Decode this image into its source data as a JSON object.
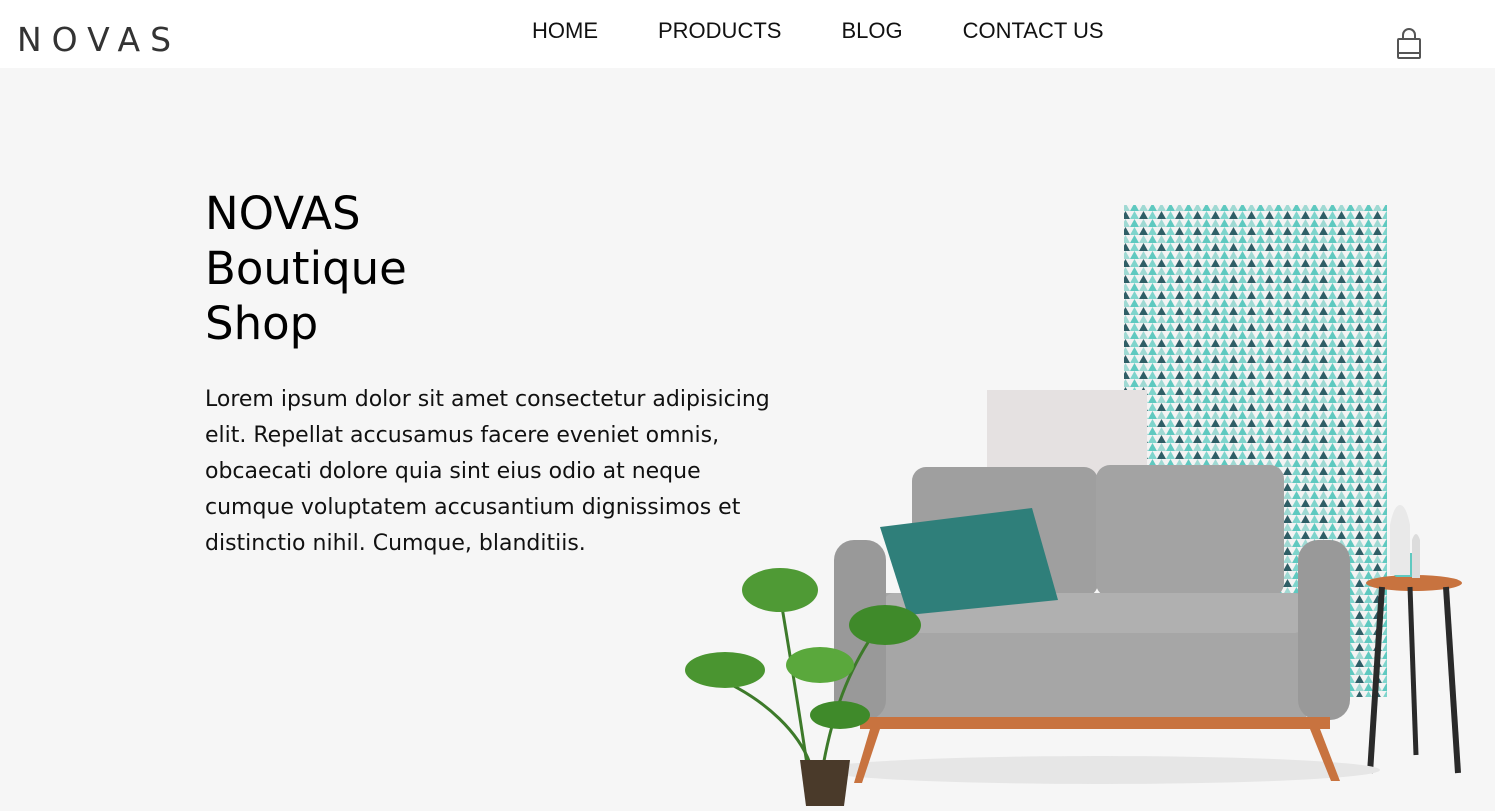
{
  "header": {
    "logo": "NOVAS",
    "nav": [
      {
        "label": "HOME"
      },
      {
        "label": "PRODUCTS"
      },
      {
        "label": "BLOG"
      },
      {
        "label": "CONTACT US"
      }
    ],
    "cart_icon": "shopping-bag-icon"
  },
  "hero": {
    "title_lines": [
      "NOVAS",
      "Boutique",
      "Shop"
    ],
    "description": "Lorem ipsum dolor sit amet consectetur adipisicing elit. Repellat accusamus facere eveniet omnis, obcaecati dolore quia sint eius odio at neque cumque voluptatem accusantium dignissimos et distinctio nihil. Cumque, blanditiis."
  },
  "colors": {
    "header_bg": "#ffffff",
    "page_bg": "#f6f6f6",
    "sofa": "#a9a9a9",
    "cushion": "#2f7f7a",
    "wood": "#c8733f",
    "pattern_teal": "#5fc9c0"
  }
}
